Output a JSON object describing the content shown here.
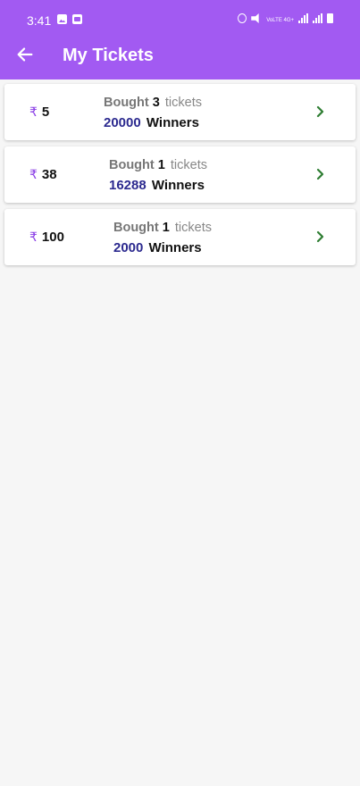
{
  "status": {
    "time": "3:41",
    "volte_label": "VoLTE 4G+"
  },
  "header": {
    "title": "My Tickets"
  },
  "tickets": [
    {
      "currency_symbol": "₹",
      "price": "5",
      "bought_label": "Bought",
      "count": "3",
      "unit": "tickets",
      "winners": "20000",
      "winners_label": "Winners"
    },
    {
      "currency_symbol": "₹",
      "price": "38",
      "bought_label": "Bought",
      "count": "1",
      "unit": "tickets",
      "winners": "16288",
      "winners_label": "Winners"
    },
    {
      "currency_symbol": "₹",
      "price": "100",
      "bought_label": "Bought",
      "count": "1",
      "unit": "tickets",
      "winners": "2000",
      "winners_label": "Winners"
    }
  ],
  "colors": {
    "app_bar": "#a25af2",
    "winners_number": "#2c2a8f",
    "chevron": "#2e7d32",
    "rupee": "#8a3ee6"
  }
}
